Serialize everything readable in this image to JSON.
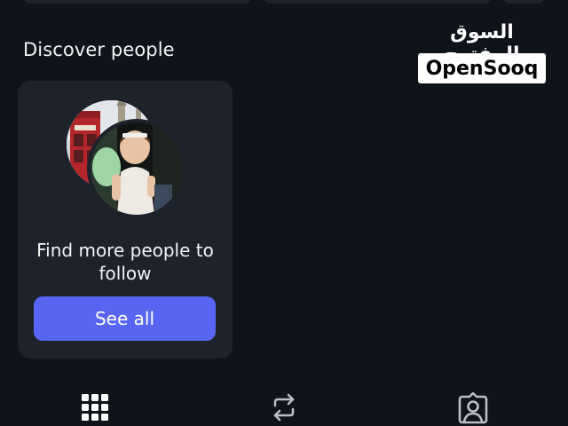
{
  "section": {
    "title": "Discover people"
  },
  "discover_card": {
    "text": "Find more people to follow",
    "button_label": "See all"
  },
  "watermark": {
    "arabic": "السوق المفتوح",
    "brand": "OpenSooq"
  },
  "tabs": [
    {
      "icon": "grid-icon"
    },
    {
      "icon": "repost-icon"
    },
    {
      "icon": "tagged-person-icon"
    }
  ],
  "colors": {
    "background": "#0f131a",
    "card": "#1d222b",
    "accent": "#5865f2"
  }
}
